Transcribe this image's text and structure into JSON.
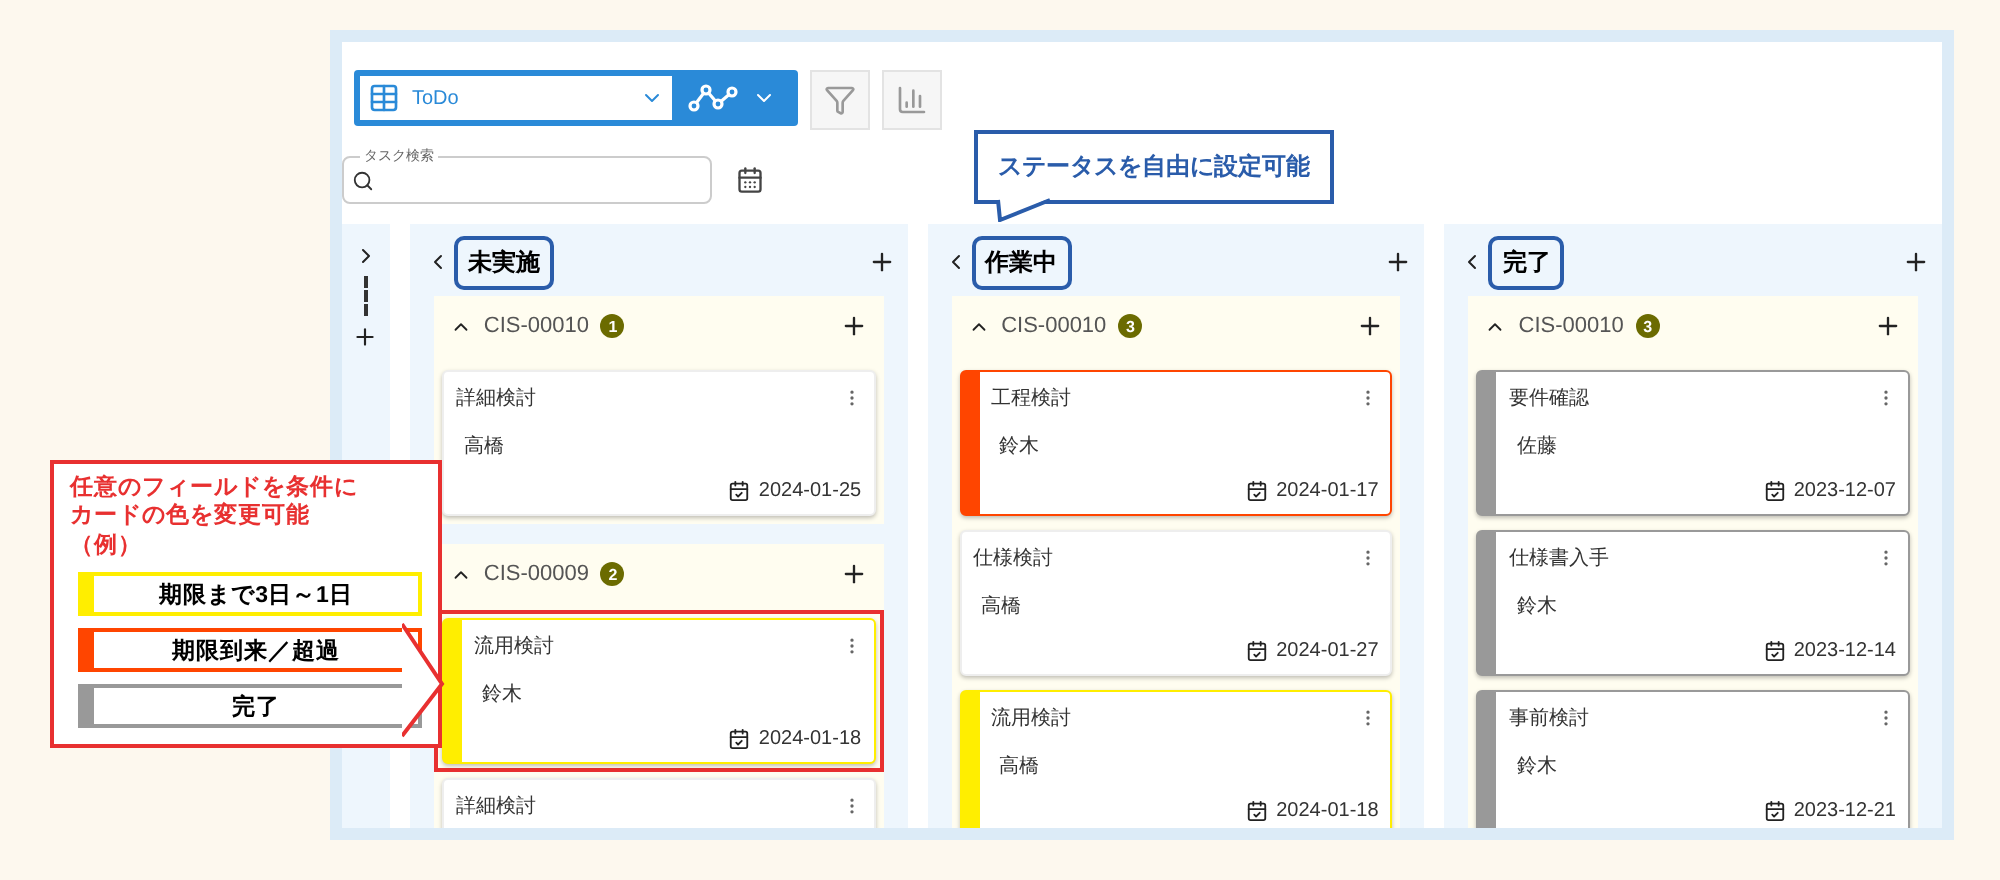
{
  "toolbar": {
    "view_select": {
      "value": "ToDo"
    }
  },
  "search": {
    "label": "タスク検索"
  },
  "columns": [
    {
      "status": "未実施",
      "lanes": [
        {
          "title": "CIS-00010",
          "count": "1",
          "cards": [
            {
              "title": "詳細検討",
              "assignee": "高橋",
              "date": "2024-01-25",
              "highlighted": false
            }
          ]
        },
        {
          "title": "CIS-00009",
          "count": "2",
          "cards": [
            {
              "title": "流用検討",
              "assignee": "鈴木",
              "date": "2024-01-18",
              "color": "#ffee00",
              "highlighted": true
            },
            {
              "title": "詳細検討",
              "highlighted": false
            }
          ]
        }
      ]
    },
    {
      "status": "作業中",
      "lanes": [
        {
          "title": "CIS-00010",
          "count": "3",
          "cards": [
            {
              "title": "工程検討",
              "assignee": "鈴木",
              "date": "2024-01-17",
              "color": "#ff4500",
              "highlighted": false
            },
            {
              "title": "仕様検討",
              "assignee": "高橋",
              "date": "2024-01-27",
              "highlighted": false
            },
            {
              "title": "流用検討",
              "assignee": "高橋",
              "date": "2024-01-18",
              "color": "#ffee00",
              "highlighted": false
            }
          ]
        }
      ]
    },
    {
      "status": "完了",
      "lanes": [
        {
          "title": "CIS-00010",
          "count": "3",
          "cards": [
            {
              "title": "要件確認",
              "assignee": "佐藤",
              "date": "2023-12-07",
              "color": "#999999",
              "highlighted": false
            },
            {
              "title": "仕様書入手",
              "assignee": "鈴木",
              "date": "2023-12-14",
              "color": "#999999",
              "highlighted": false
            },
            {
              "title": "事前検討",
              "assignee": "鈴木",
              "date": "2023-12-21",
              "color": "#999999",
              "highlighted": false
            }
          ]
        }
      ]
    }
  ],
  "status_callout": {
    "text": "ステータスを自由に設定可能"
  },
  "color_callout": {
    "lines": [
      "任意のフィールドを条件に",
      "カードの色を変更可能",
      "（例）"
    ],
    "legend": [
      {
        "label": "期限まで3日～1日",
        "color": "#ffee00"
      },
      {
        "label": "期限到来／超過",
        "color": "#ff4500"
      },
      {
        "label": "完了",
        "color": "#999999"
      }
    ]
  }
}
